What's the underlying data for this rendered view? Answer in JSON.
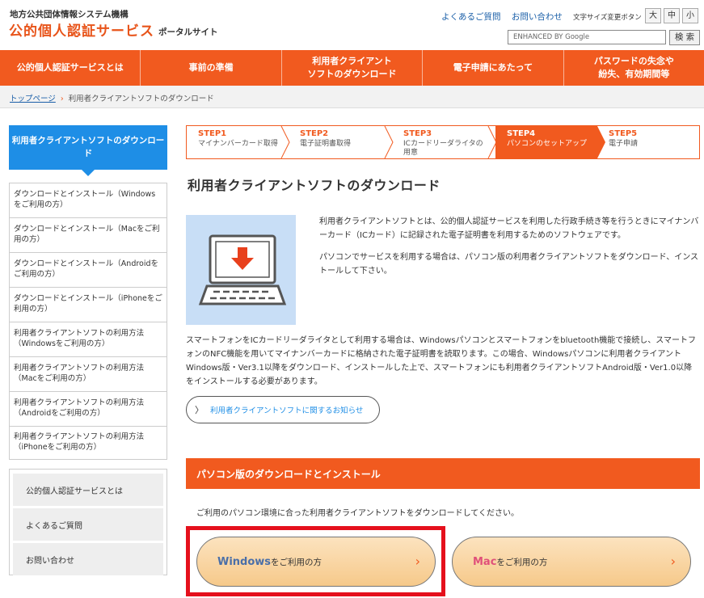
{
  "header": {
    "org": "地方公共団体情報システム機構",
    "site_name": "公的個人認証サービス",
    "site_sub": "ポータルサイト",
    "faq": "よくあるご質問",
    "contact": "お問い合わせ",
    "fontsize_label": "文字サイズ変更ボタン",
    "fontsize_large": "大",
    "fontsize_medium": "中",
    "fontsize_small": "小",
    "search_placeholder": "ENHANCED BY Google",
    "search_button": "検 索"
  },
  "gnav": [
    {
      "label": "公的個人認証サービスとは"
    },
    {
      "label": "事前の準備"
    },
    {
      "label": "利用者クライアント\nソフトのダウンロード"
    },
    {
      "label": "電子申請にあたって"
    },
    {
      "label": "パスワードの失念や\n紛失、有効期間等"
    }
  ],
  "breadcrumb": {
    "home": "トップページ",
    "sep": "›",
    "current": "利用者クライアントソフトのダウンロード"
  },
  "sidebar": {
    "heading": "利用者クライアントソフトのダウンロード",
    "items": [
      {
        "label": "ダウンロードとインストール（Windowsをご利用の方）"
      },
      {
        "label": "ダウンロードとインストール（Macをご利用の方）"
      },
      {
        "label": "ダウンロードとインストール（Androidをご利用の方）"
      },
      {
        "label": "ダウンロードとインストール（iPhoneをご利用の方）"
      },
      {
        "label": "利用者クライアントソフトの利用方法（Windowsをご利用の方）"
      },
      {
        "label": "利用者クライアントソフトの利用方法（Macをご利用の方）"
      },
      {
        "label": "利用者クライアントソフトの利用方法（Androidをご利用の方）"
      },
      {
        "label": "利用者クライアントソフトの利用方法（iPhoneをご利用の方）"
      }
    ],
    "links": [
      {
        "label": "公的個人認証サービスとは"
      },
      {
        "label": "よくあるご質問"
      },
      {
        "label": "お問い合わせ"
      }
    ]
  },
  "steps": [
    {
      "num": "STEP1",
      "label": "マイナンバーカード取得",
      "active": false
    },
    {
      "num": "STEP2",
      "label": "電子証明書取得",
      "active": false
    },
    {
      "num": "STEP3",
      "label": "ICカードリーダライタの用意",
      "active": false
    },
    {
      "num": "STEP4",
      "label": "パソコンのセットアップ",
      "active": true
    },
    {
      "num": "STEP5",
      "label": "電子申請",
      "active": false
    }
  ],
  "main": {
    "title": "利用者クライアントソフトのダウンロード",
    "intro1": "利用者クライアントソフトとは、公的個人認証サービスを利用した行政手続き等を行うときにマイナンバーカード（ICカード）に記録された電子証明書を利用するためのソフトウェアです。",
    "intro2": "パソコンでサービスを利用する場合は、パソコン版の利用者クライアントソフトをダウンロード、インストールして下さい。",
    "para": "スマートフォンをICカードリーダライタとして利用する場合は、Windowsパソコンとスマートフォンをbluetooth機能で接続し、スマートフォンのNFC機能を用いてマイナンバーカードに格納された電子証明書を読取ります。この場合、Windowsパソコンに利用者クライアントWindows版・Ver3.1以降をダウンロード、インストールした上で、スマートフォンにも利用者クライアントソフトAndroid版・Ver1.0以降をインストールする必要があります。",
    "notice_link": "利用者クライアントソフトに関するお知らせ",
    "section_title": "パソコン版のダウンロードとインストール",
    "instruction": "ご利用のパソコン環境に合った利用者クライアントソフトをダウンロードしてください。",
    "windows_os": "Windows",
    "windows_suffix": "をご利用の方",
    "mac_os": "Mac",
    "mac_suffix": "をご利用の方"
  },
  "colors": {
    "accent": "#f15a1f",
    "sidebar_head": "#1e8ee6",
    "highlight_frame": "#e5101c",
    "link": "#1a5fa8"
  }
}
